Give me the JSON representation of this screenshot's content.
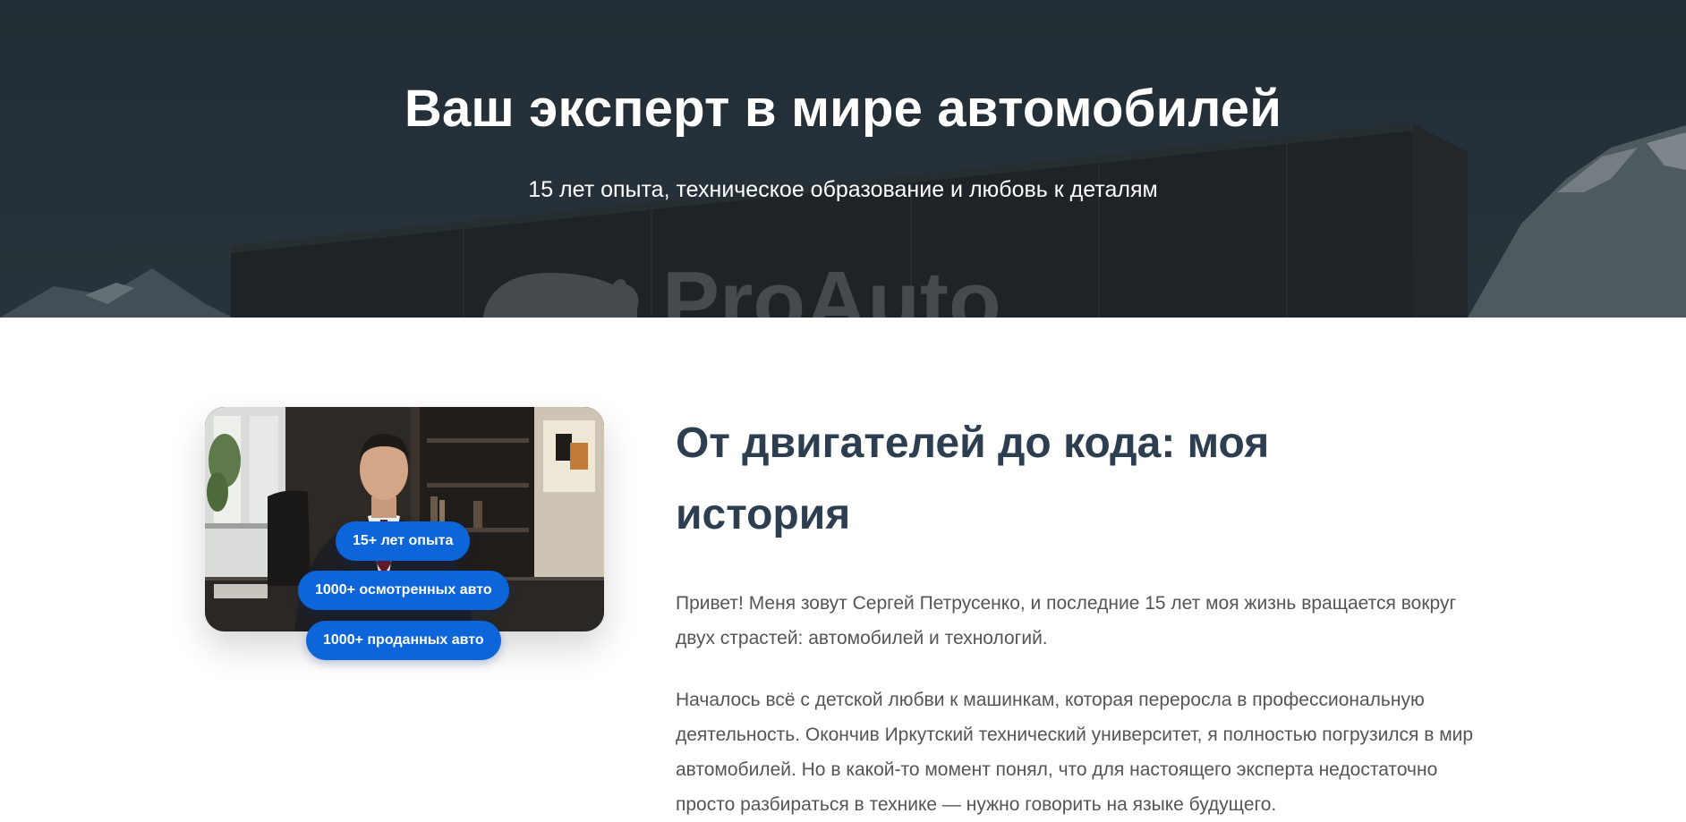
{
  "hero": {
    "title": "Ваш эксперт в мире автомобилей",
    "subtitle": "15 лет опыта, техническое образование и любовь к деталям",
    "background_sign_text": "ProAuto",
    "colors": {
      "overlay": "#263139",
      "text": "#ffffff"
    }
  },
  "about": {
    "badges": [
      {
        "label": "15+ лет опыта"
      },
      {
        "label": "1000+ осмотренных авто"
      },
      {
        "label": "1000+ проданных авто"
      }
    ],
    "title": "От двигателей до кода: моя история",
    "paragraphs": [
      "Привет! Меня зовут Сергей Петрусенко, и последние 15 лет моя жизнь вращается вокруг двух страстей: автомобилей и технологий.",
      "Началось всё с детской любви к машинкам, которая переросла в профессиональную деятельность. Окончив Иркутский технический университет, я полностью погрузился в мир автомобилей. Но в какой-то момент понял, что для настоящего эксперта недостаточно просто разбираться в технике — нужно говорить на языке будущего."
    ],
    "colors": {
      "accent": "#0c66d9",
      "heading": "#2c3e50",
      "body": "#555555"
    }
  }
}
